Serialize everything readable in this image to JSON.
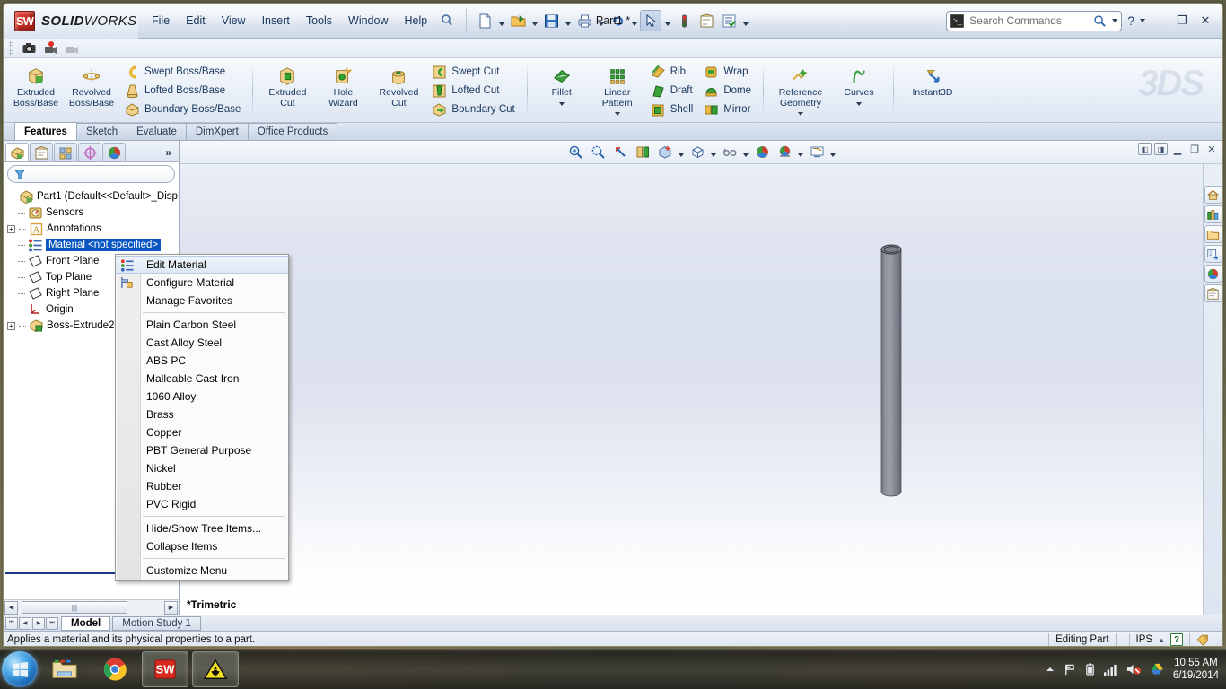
{
  "app": {
    "brand_bold": "SOLID",
    "brand_thin": "WORKS",
    "cube_text": "SW",
    "document_title": "Part1 *"
  },
  "menubar": {
    "items": [
      "File",
      "Edit",
      "View",
      "Insert",
      "Tools",
      "Window",
      "Help"
    ],
    "pin_icon": "pushpin-icon"
  },
  "quick_access": {
    "buttons": [
      {
        "name": "new-document-button",
        "icon": "new-file-icon",
        "caret": true
      },
      {
        "name": "open-document-button",
        "icon": "open-folder-icon",
        "caret": true
      },
      {
        "name": "save-button",
        "icon": "save-disk-icon",
        "caret": true
      },
      {
        "name": "print-button",
        "icon": "printer-icon",
        "caret": true
      },
      {
        "name": "undo-button",
        "icon": "undo-arrow-icon",
        "caret": true
      },
      {
        "name": "select-button",
        "icon": "cursor-arrow-icon",
        "caret": true,
        "pressed": true
      },
      {
        "name": "rebuild-button",
        "icon": "traffic-light-icon",
        "caret": false
      },
      {
        "name": "file-properties-button",
        "icon": "properties-icon",
        "caret": false
      },
      {
        "name": "options-button",
        "icon": "options-checklist-icon",
        "caret": true
      }
    ]
  },
  "search": {
    "placeholder": "Search Commands",
    "icon": "search-magnifier-icon",
    "sw_icon": "solidworks-search-icon"
  },
  "window_controls": {
    "help": "?",
    "minimize": "–",
    "restore": "❐",
    "close": "✕"
  },
  "sub_toolbar": {
    "buttons": [
      {
        "name": "screen-capture-button",
        "icon": "camera-icon"
      },
      {
        "name": "record-video-button",
        "icon": "record-camera-icon"
      },
      {
        "name": "stop-record-button",
        "icon": "stop-record-icon"
      }
    ]
  },
  "ribbon": {
    "watermark": "3DS",
    "groups": [
      {
        "name": "boss-base-group",
        "big": [
          {
            "label_top": "Extruded",
            "label_bottom": "Boss/Base",
            "icon": "extruded-boss-icon"
          },
          {
            "label_top": "Revolved",
            "label_bottom": "Boss/Base",
            "icon": "revolved-boss-icon"
          }
        ],
        "rows": [
          {
            "label": "Swept Boss/Base",
            "icon": "swept-boss-icon"
          },
          {
            "label": "Lofted Boss/Base",
            "icon": "lofted-boss-icon"
          },
          {
            "label": "Boundary Boss/Base",
            "icon": "boundary-boss-icon"
          }
        ]
      },
      {
        "name": "cut-group",
        "big": [
          {
            "label_top": "Extruded",
            "label_bottom": "Cut",
            "icon": "extruded-cut-icon"
          },
          {
            "label_top": "Hole",
            "label_bottom": "Wizard",
            "icon": "hole-wizard-icon"
          },
          {
            "label_top": "Revolved",
            "label_bottom": "Cut",
            "icon": "revolved-cut-icon"
          }
        ],
        "rows": [
          {
            "label": "Swept Cut",
            "icon": "swept-cut-icon"
          },
          {
            "label": "Lofted Cut",
            "icon": "lofted-cut-icon"
          },
          {
            "label": "Boundary Cut",
            "icon": "boundary-cut-icon"
          }
        ]
      },
      {
        "name": "features-group",
        "big": [
          {
            "label_top": "Fillet",
            "label_bottom": "",
            "icon": "fillet-icon",
            "caret": true
          },
          {
            "label_top": "Linear",
            "label_bottom": "Pattern",
            "icon": "linear-pattern-icon",
            "caret": true
          }
        ],
        "rows": [
          {
            "label": "Rib",
            "icon": "rib-icon"
          },
          {
            "label": "Draft",
            "icon": "draft-icon"
          },
          {
            "label": "Shell",
            "icon": "shell-icon"
          }
        ],
        "rows2": [
          {
            "label": "Wrap",
            "icon": "wrap-icon"
          },
          {
            "label": "Dome",
            "icon": "dome-icon"
          },
          {
            "label": "Mirror",
            "icon": "mirror-icon"
          }
        ]
      },
      {
        "name": "reference-group",
        "big": [
          {
            "label_top": "Reference",
            "label_bottom": "Geometry",
            "icon": "reference-geometry-icon",
            "caret": true
          },
          {
            "label_top": "Curves",
            "label_bottom": "",
            "icon": "curves-icon",
            "caret": true
          }
        ]
      },
      {
        "name": "instant3d-group",
        "big": [
          {
            "label_top": "Instant3D",
            "label_bottom": "",
            "icon": "instant3d-icon"
          }
        ]
      }
    ]
  },
  "command_tabs": {
    "active": "Features",
    "items": [
      "Features",
      "Sketch",
      "Evaluate",
      "DimXpert",
      "Office Products"
    ]
  },
  "feature_manager": {
    "tabs": [
      {
        "name": "feature-tree-tab",
        "icon": "feature-tree-icon",
        "active": true
      },
      {
        "name": "property-manager-tab",
        "icon": "property-manager-icon",
        "active": false
      },
      {
        "name": "configuration-manager-tab",
        "icon": "configuration-icon",
        "active": false
      },
      {
        "name": "dimxpert-manager-tab",
        "icon": "dimxpert-icon",
        "active": false
      },
      {
        "name": "display-manager-tab",
        "icon": "display-manager-icon",
        "active": false
      }
    ],
    "more_label": "»",
    "filter_icon": "filter-funnel-icon",
    "tree": [
      {
        "label": "Part1  (Default<<Default>_Disp",
        "icon": "part-icon",
        "depth": 0,
        "expander": "none",
        "selected": false
      },
      {
        "label": "Sensors",
        "icon": "sensors-icon",
        "depth": 1,
        "expander": "none",
        "selected": false
      },
      {
        "label": "Annotations",
        "icon": "annotations-icon",
        "depth": 1,
        "expander": "plus",
        "selected": false
      },
      {
        "label": "Material <not specified>",
        "icon": "material-icon",
        "depth": 1,
        "expander": "none",
        "selected": true
      },
      {
        "label": "Front Plane",
        "icon": "plane-icon",
        "depth": 1,
        "expander": "none",
        "selected": false
      },
      {
        "label": "Top Plane",
        "icon": "plane-icon",
        "depth": 1,
        "expander": "none",
        "selected": false
      },
      {
        "label": "Right Plane",
        "icon": "plane-icon",
        "depth": 1,
        "expander": "none",
        "selected": false
      },
      {
        "label": "Origin",
        "icon": "origin-icon",
        "depth": 1,
        "expander": "none",
        "selected": false
      },
      {
        "label": "Boss-Extrude2",
        "icon": "boss-extrude-icon",
        "depth": 1,
        "expander": "plus",
        "selected": false
      }
    ],
    "scroll": {
      "left_arrow": "◀",
      "right_arrow": "▶",
      "thumb_grip": "|||"
    }
  },
  "context_menu": {
    "sections": [
      {
        "items": [
          {
            "label": "Edit Material",
            "icon": "material-icon",
            "highlighted": true
          },
          {
            "label": "Configure Material",
            "icon": "configure-material-icon",
            "highlighted": false
          },
          {
            "label": "Manage Favorites",
            "icon": null,
            "highlighted": false
          }
        ]
      },
      {
        "items": [
          {
            "label": "Plain Carbon Steel",
            "icon": null,
            "highlighted": false
          },
          {
            "label": "Cast Alloy Steel",
            "icon": null,
            "highlighted": false
          },
          {
            "label": "ABS PC",
            "icon": null,
            "highlighted": false
          },
          {
            "label": "Malleable Cast Iron",
            "icon": null,
            "highlighted": false
          },
          {
            "label": "1060 Alloy",
            "icon": null,
            "highlighted": false
          },
          {
            "label": "Brass",
            "icon": null,
            "highlighted": false
          },
          {
            "label": "Copper",
            "icon": null,
            "highlighted": false
          },
          {
            "label": "PBT General Purpose",
            "icon": null,
            "highlighted": false
          },
          {
            "label": "Nickel",
            "icon": null,
            "highlighted": false
          },
          {
            "label": "Rubber",
            "icon": null,
            "highlighted": false
          },
          {
            "label": "PVC Rigid",
            "icon": null,
            "highlighted": false
          }
        ]
      },
      {
        "items": [
          {
            "label": "Hide/Show Tree Items...",
            "icon": null,
            "highlighted": false
          },
          {
            "label": "Collapse Items",
            "icon": null,
            "highlighted": false
          }
        ]
      },
      {
        "items": [
          {
            "label": "Customize Menu",
            "icon": null,
            "highlighted": false
          }
        ]
      }
    ]
  },
  "view_toolbar": {
    "buttons": [
      {
        "name": "zoom-to-fit-button",
        "icon": "zoom-fit-icon",
        "caret": false
      },
      {
        "name": "zoom-to-area-button",
        "icon": "zoom-area-icon",
        "caret": false
      },
      {
        "name": "previous-view-button",
        "icon": "previous-view-icon",
        "caret": false
      },
      {
        "name": "section-view-button",
        "icon": "section-view-icon",
        "caret": false
      },
      {
        "name": "view-orientation-button",
        "icon": "view-orientation-icon",
        "caret": true
      },
      {
        "name": "display-style-button",
        "icon": "display-style-cube-icon",
        "caret": true
      },
      {
        "name": "hide-show-items-button",
        "icon": "glasses-icon",
        "caret": true
      },
      {
        "name": "edit-appearance-button",
        "icon": "appearance-sphere-icon",
        "caret": false
      },
      {
        "name": "apply-scene-button",
        "icon": "scene-sphere-icon",
        "caret": true
      },
      {
        "name": "view-settings-button",
        "icon": "view-settings-icon",
        "caret": true
      }
    ]
  },
  "viewport": {
    "orientation_label": "*Trimetric",
    "window_buttons": [
      "restore-left-icon",
      "restore-right-icon",
      "minimize-icon",
      "restore-icon",
      "close-icon"
    ],
    "model_color": "#7d828c",
    "background_top": "#e0e5f0",
    "background_bottom": "#ffffff"
  },
  "right_dock": {
    "buttons": [
      {
        "name": "design-library-home-button",
        "icon": "home-icon"
      },
      {
        "name": "design-library-button",
        "icon": "library-icon"
      },
      {
        "name": "file-explorer-button",
        "icon": "folder-icon"
      },
      {
        "name": "search-panel-button",
        "icon": "search-panel-icon"
      },
      {
        "name": "appearances-button",
        "icon": "appearances-sphere-icon"
      },
      {
        "name": "custom-properties-button",
        "icon": "custom-properties-icon"
      }
    ]
  },
  "bottom_tabs": {
    "nav": [
      "⏮",
      "◀",
      "▶",
      "⏭"
    ],
    "tabs": [
      {
        "label": "Model",
        "active": true
      },
      {
        "label": "Motion Study 1",
        "active": false
      }
    ]
  },
  "status_bar": {
    "message": "Applies a material and its physical properties to a part.",
    "editing_state": "Editing Part",
    "units": "IPS",
    "units_caret": "▲",
    "help_badge": "?",
    "tag_icon": "tag-icon"
  },
  "taskbar": {
    "start_icon": "windows-start-orb",
    "items": [
      {
        "name": "taskbar-explorer",
        "icon": "folder-explorer-icon",
        "running": false
      },
      {
        "name": "taskbar-chrome",
        "icon": "chrome-icon",
        "running": false
      },
      {
        "name": "taskbar-solidworks",
        "icon": "solidworks-icon",
        "running": true
      },
      {
        "name": "taskbar-hazard-app",
        "icon": "hazard-triangle-icon",
        "running": true
      }
    ],
    "tray": [
      {
        "name": "show-hidden-icons",
        "icon": "chevron-up-icon"
      },
      {
        "name": "action-center",
        "icon": "flag-icon"
      },
      {
        "name": "battery-status",
        "icon": "battery-icon"
      },
      {
        "name": "network-status",
        "icon": "signal-bars-icon"
      },
      {
        "name": "volume-muted",
        "icon": "speaker-muted-icon"
      },
      {
        "name": "google-drive",
        "icon": "google-drive-icon"
      }
    ],
    "clock_time": "10:55 AM",
    "clock_date": "6/19/2014"
  }
}
